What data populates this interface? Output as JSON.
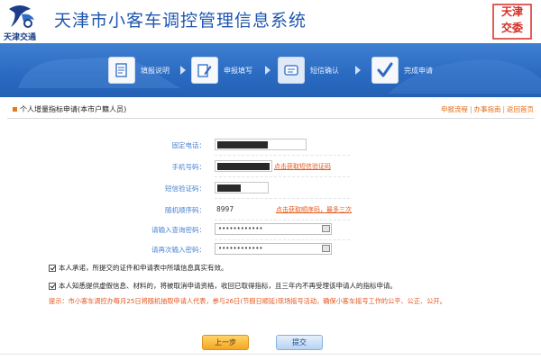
{
  "header": {
    "logo_text": "天津交通",
    "title": "天津市小客车调控管理信息系统",
    "seal_text": [
      "天津",
      "交委"
    ]
  },
  "steps": [
    {
      "label": "填报说明"
    },
    {
      "label": "申报填写"
    },
    {
      "label": "短信确认"
    },
    {
      "label": "完成申请"
    }
  ],
  "panel": {
    "title": "个人增量指标申请(本市户籍人员)",
    "links": [
      "申报流程",
      "办事指南",
      "返回首页"
    ]
  },
  "form": {
    "landline_label": "固定电话：",
    "mobile_label": "手机号码：",
    "mobile_action": "点击获取短信验证码",
    "sms_label": "短信验证码：",
    "random_label": "随机顺序码：",
    "random_value": "8997",
    "random_action": "点击获取顺序码，最多三次",
    "pwd_label": "请输入查询密码：",
    "pwd_value": "••••••••••••",
    "pwd2_label": "请再次输入密码：",
    "pwd2_value": "••••••••••••"
  },
  "checks": {
    "promise": "本人承诺，所提交的证件和申请表中所填信息真实有效。",
    "aware": "本人知悉提供虚假信息、材料的，将被取消申请资格，收回已取得指标，且三年内不再受理该申请人的指标申请。"
  },
  "notice": "提示：市小客车调控办每月25日将随机抽取申请人代表，参与26日(节假日顺延)现场摇号活动，确保小客车摇号工作的公平、公正、公开。",
  "buttons": {
    "prev": "上一步",
    "submit": "提交"
  },
  "colors": {
    "title_blue": "#1f56b0",
    "banner_blue": "#2b6bc2",
    "link_orange": "#e26a14",
    "label_blue": "#4a83cf",
    "seal_red": "#d72a22"
  }
}
